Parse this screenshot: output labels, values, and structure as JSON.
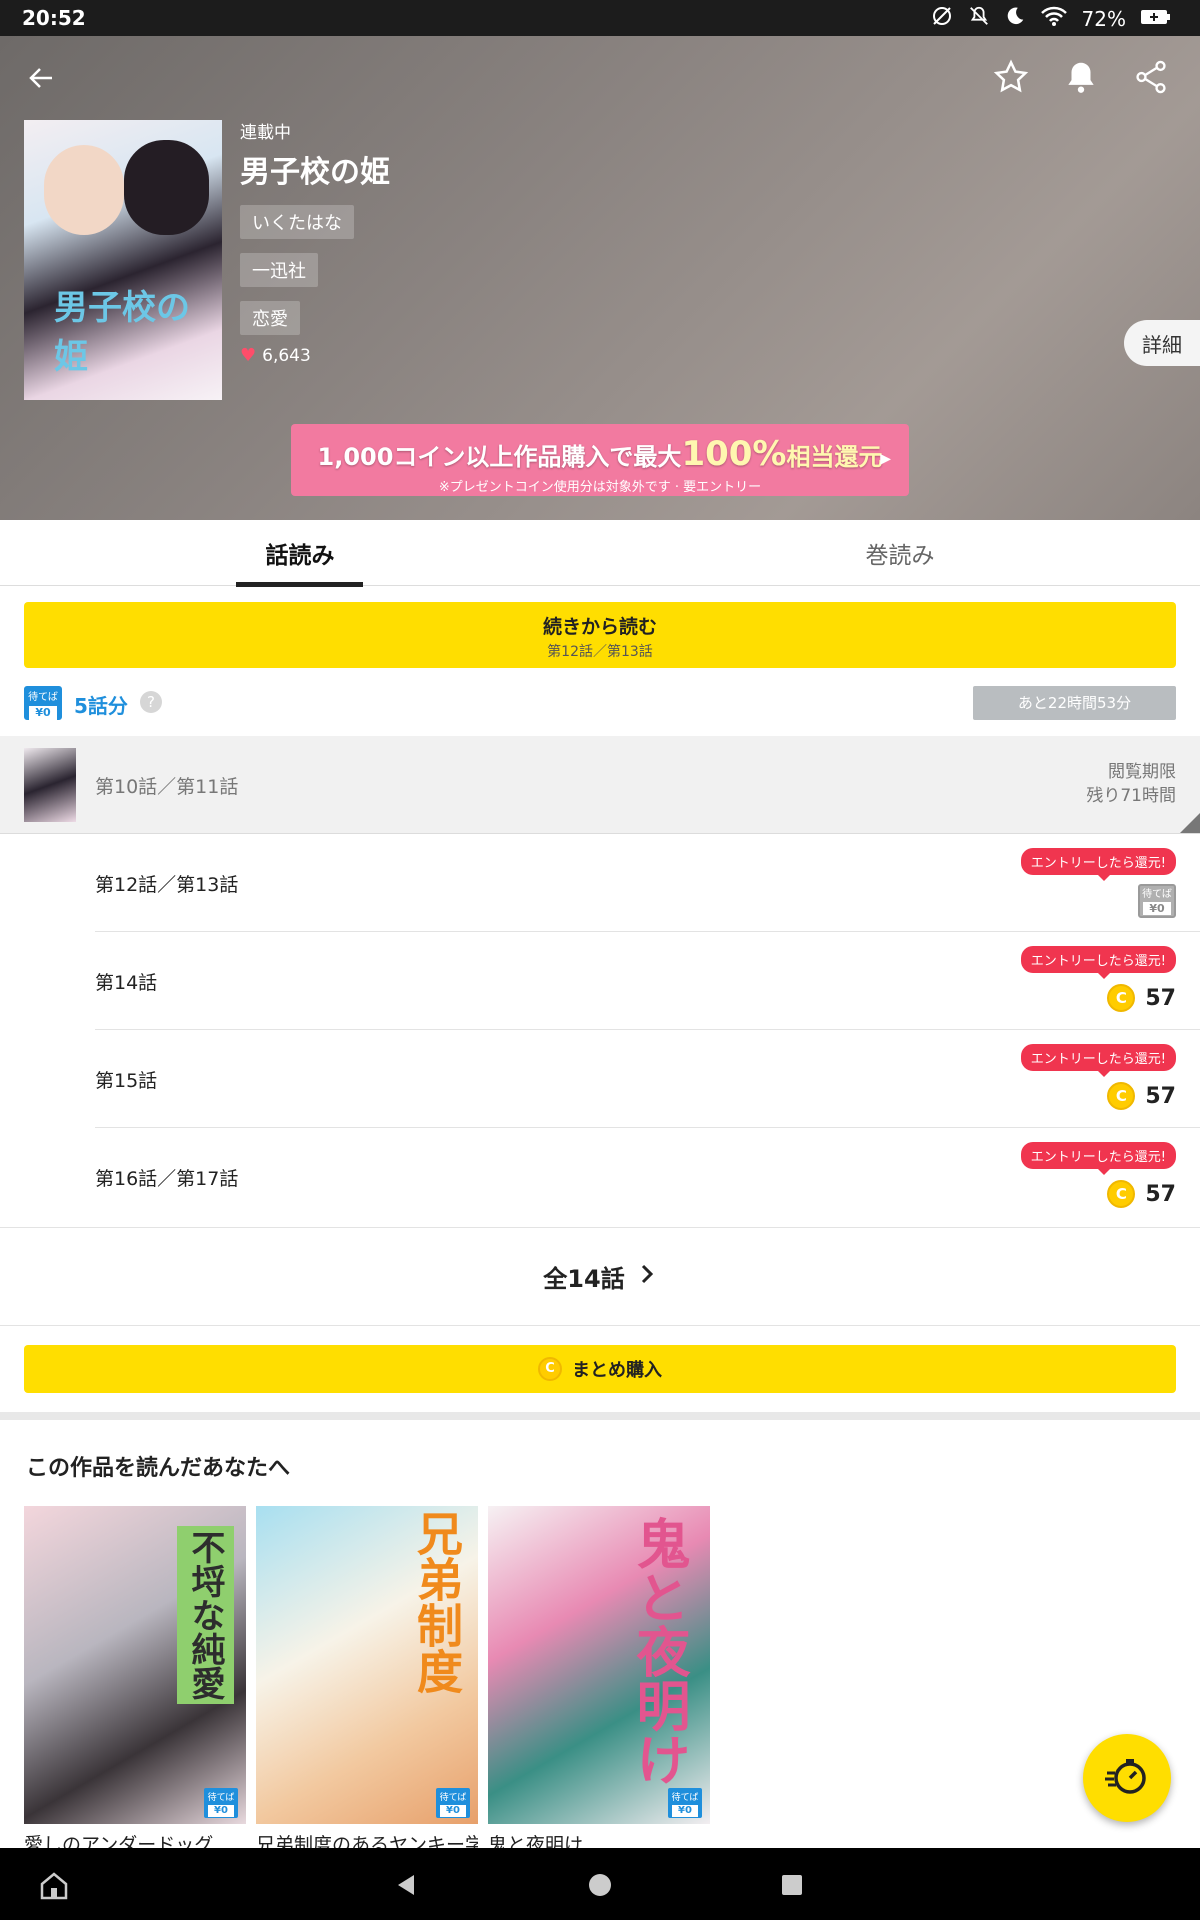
{
  "status_bar": {
    "time": "20:52",
    "battery": "72%"
  },
  "hero": {
    "serial_status": "連載中",
    "title": "男子校の姫",
    "author": "いくたはな",
    "publisher": "一迅社",
    "genre": "恋愛",
    "likes": "6,643",
    "detail_label": "詳細",
    "cover_text": "男子校の姫",
    "banner": {
      "prefix": "1,000コイン以上作品購入で最大",
      "highlight": "100%",
      "suffix": "相当還元",
      "note": "※プレゼントコイン使用分は対象外です · 要エントリー"
    }
  },
  "tabs": [
    {
      "label": "話読み",
      "active": true
    },
    {
      "label": "巻読み",
      "active": false
    }
  ],
  "continue": {
    "label": "続きから読む",
    "episode": "第12話／第13話"
  },
  "wait_free": {
    "badge_top": "待てば",
    "badge_bottom": "¥0",
    "count": "5話分",
    "help": "?",
    "remaining": "あと22時間53分"
  },
  "episodes": [
    {
      "title": "第10話／第11話",
      "limit_line1": "閲覧期限",
      "limit_line2": "残り71時間"
    },
    {
      "title": "第12話／第13話",
      "entry": "エントリーしたら還元!",
      "badge_top": "待てば",
      "badge_bottom": "¥0"
    },
    {
      "title": "第14話",
      "entry": "エントリーしたら還元!",
      "coin": "C",
      "price": "57"
    },
    {
      "title": "第15話",
      "entry": "エントリーしたら還元!",
      "coin": "C",
      "price": "57"
    },
    {
      "title": "第16話／第17話",
      "entry": "エントリーしたら還元!",
      "coin": "C",
      "price": "57"
    }
  ],
  "all_episodes": "全14話",
  "bulk_purchase": {
    "coin": "C",
    "label": "まとめ購入"
  },
  "recommend": {
    "title": "この作品を読んだあなたへ",
    "items": [
      {
        "name": "愛しのアンダードッグ",
        "cover_text": "不埒な純愛",
        "badge_top": "待てば",
        "badge_bottom": "¥0"
      },
      {
        "name": "兄弟制度のあるヤンキー学園で、今日も契りを迫られてます",
        "cover_text": "兄弟制度",
        "badge_top": "待てば",
        "badge_bottom": "¥0"
      },
      {
        "name": "鬼と夜明け",
        "cover_text": "鬼と夜明け",
        "badge_top": "待てば",
        "badge_bottom": "¥0"
      }
    ]
  },
  "colors": {
    "accent_yellow": "#ffde00",
    "wait_blue": "#1f8fdc",
    "entry_red": "#f0354f",
    "banner_pink": "#f27aa0"
  }
}
